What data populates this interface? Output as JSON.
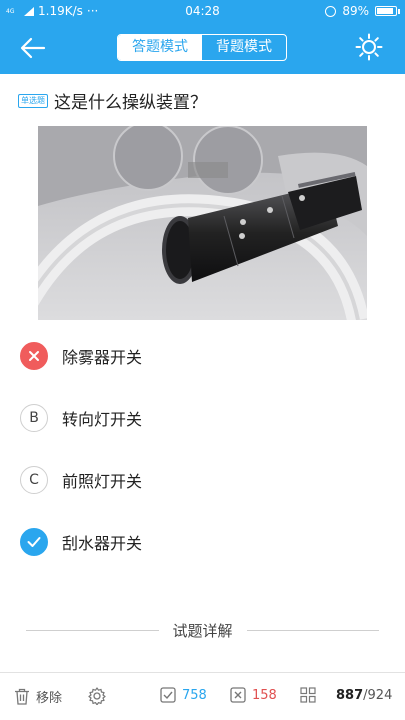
{
  "status_bar": {
    "network_type": "4G",
    "speed": "1.19K/s",
    "dots": "···",
    "time": "04:28",
    "battery": "89%",
    "battery_level": 0.89
  },
  "header": {
    "modes": [
      "答题模式",
      "背题模式"
    ],
    "active_mode_index": 0
  },
  "question": {
    "type_badge": "单选题",
    "text": "这是什么操纵装置？"
  },
  "options": [
    {
      "mark": "",
      "label": "除雾器开关",
      "state": "wrong"
    },
    {
      "mark": "B",
      "label": "转向灯开关",
      "state": "normal"
    },
    {
      "mark": "C",
      "label": "前照灯开关",
      "state": "normal"
    },
    {
      "mark": "",
      "label": "刮水器开关",
      "state": "correct"
    }
  ],
  "details": {
    "title": "试题详解"
  },
  "bottom_bar": {
    "remove_label": "移除",
    "correct_count": "758",
    "wrong_count": "158",
    "progress_current": "887",
    "progress_total": "/924"
  },
  "colors": {
    "accent": "#2aa6ee",
    "wrong": "#f05c5c",
    "correct_count": "#2aa6ee",
    "wrong_count": "#e05050"
  }
}
